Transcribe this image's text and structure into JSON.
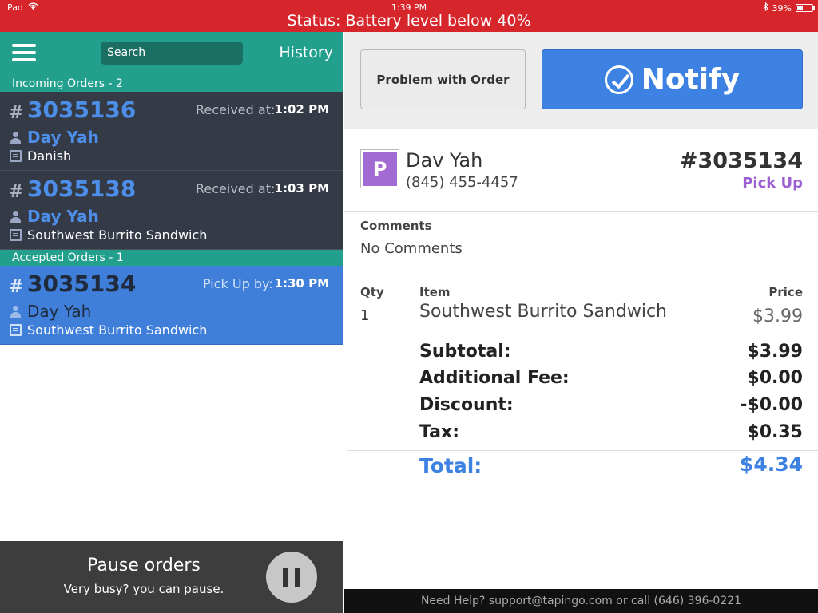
{
  "status_bar": {
    "device": "iPad",
    "time": "1:39 PM",
    "battery_percent": "39%",
    "battery_level": 0.39,
    "message": "Status: Battery level below 40%"
  },
  "left_header": {
    "search_placeholder": "Search",
    "history_label": "History"
  },
  "incoming": {
    "header": "Incoming Orders - 2",
    "orders": [
      {
        "hash": "#",
        "number": "3035136",
        "time_label": "Received at:",
        "time": "1:02 PM",
        "customer": "Day Yah",
        "item": "Danish"
      },
      {
        "hash": "#",
        "number": "3035138",
        "time_label": "Received at:",
        "time": "1:03 PM",
        "customer": "Day Yah",
        "item": "Southwest Burrito Sandwich"
      }
    ]
  },
  "accepted": {
    "header": "Accepted Orders - 1",
    "orders": [
      {
        "hash": "#",
        "number": "3035134",
        "time_label": "Pick Up by:",
        "time": "1:30 PM",
        "customer": "Day Yah",
        "item": "Southwest Burrito Sandwich"
      }
    ]
  },
  "pause": {
    "title": "Pause orders",
    "subtitle": "Very busy? you can pause."
  },
  "actions": {
    "problem_label": "Problem with Order",
    "notify_label": "Notify"
  },
  "detail": {
    "avatar_letter": "P",
    "customer_name": "Dav Yah",
    "phone": "(845) 455-4457",
    "order_id": "#3035134",
    "order_type": "Pick Up",
    "comments_label": "Comments",
    "comments_text": "No Comments",
    "col_qty": "Qty",
    "col_item": "Item",
    "col_price": "Price",
    "line_items": [
      {
        "qty": "1",
        "name": "Southwest Burrito Sandwich",
        "price": "$3.99"
      }
    ],
    "subtotal_label": "Subtotal:",
    "subtotal": "$3.99",
    "fee_label": "Additional Fee:",
    "fee": "$0.00",
    "discount_label": "Discount:",
    "discount": "-$0.00",
    "tax_label": "Tax:",
    "tax": "$0.35",
    "total_label": "Total:",
    "total": "$4.34"
  },
  "help_text": "Need Help? support@tapingo.com or call (646) 396-0221",
  "colors": {
    "status_red": "#d6262b",
    "teal": "#22a08d",
    "dark_row": "#353a47",
    "selected_blue": "#3f7fda",
    "accent_blue": "#3d82e2",
    "pickup_purple": "#9c5fd0"
  }
}
